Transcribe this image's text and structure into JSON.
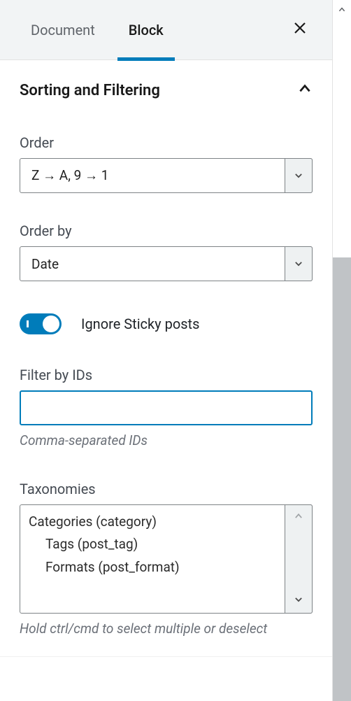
{
  "tabs": {
    "document": "Document",
    "block": "Block",
    "active_index": 1
  },
  "panel": {
    "title": "Sorting and Filtering",
    "expanded": true
  },
  "fields": {
    "order": {
      "label": "Order",
      "value": "Z → A, 9 → 1"
    },
    "order_by": {
      "label": "Order by",
      "value": "Date"
    },
    "ignore_sticky": {
      "label": "Ignore Sticky posts",
      "enabled": true
    },
    "filter_ids": {
      "label": "Filter by IDs",
      "value": "",
      "help": "Comma-separated IDs"
    },
    "taxonomies": {
      "label": "Taxonomies",
      "options": [
        "Categories (category)",
        "Tags (post_tag)",
        "Formats (post_format)"
      ],
      "help": "Hold ctrl/cmd to select multiple or deselect"
    }
  },
  "colors": {
    "accent": "#007cba"
  }
}
